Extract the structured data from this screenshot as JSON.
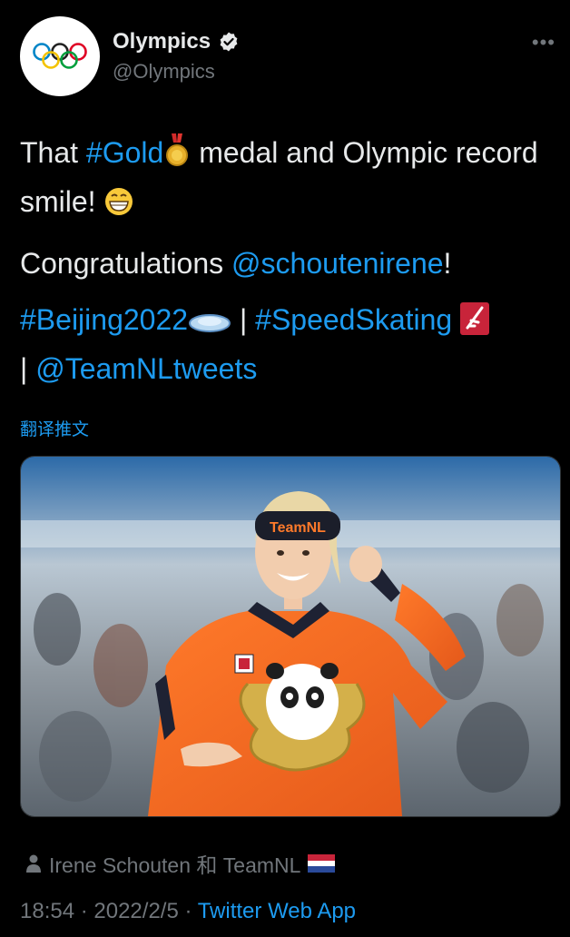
{
  "account": {
    "display_name": "Olympics",
    "handle": "@Olympics"
  },
  "tweet": {
    "line1_pre": "That ",
    "line1_tag": "#Gold",
    "line1_post": " medal and Olympic record smile! ",
    "line2_pre": "Congratulations ",
    "line2_mention": "@schoutenirene",
    "line2_post": "!",
    "line3_tag1": "#Beijing2022",
    "line3_sep1": " | ",
    "line3_tag2": "#SpeedSkating",
    "line3_sep2": " | ",
    "line3_mention": "@TeamNLtweets"
  },
  "translate_label": "翻译推文",
  "media": {
    "headband_text": "TeamNL"
  },
  "tagged": {
    "label": "Irene Schouten 和 TeamNL"
  },
  "meta": {
    "time": "18:54",
    "sep1": " · ",
    "date": "2022/2/5",
    "sep2": " · ",
    "source": "Twitter Web App"
  },
  "colors": {
    "background": "#000000",
    "link": "#1d9bf0",
    "secondary": "#71767b",
    "jacket": "#f26b1d"
  }
}
